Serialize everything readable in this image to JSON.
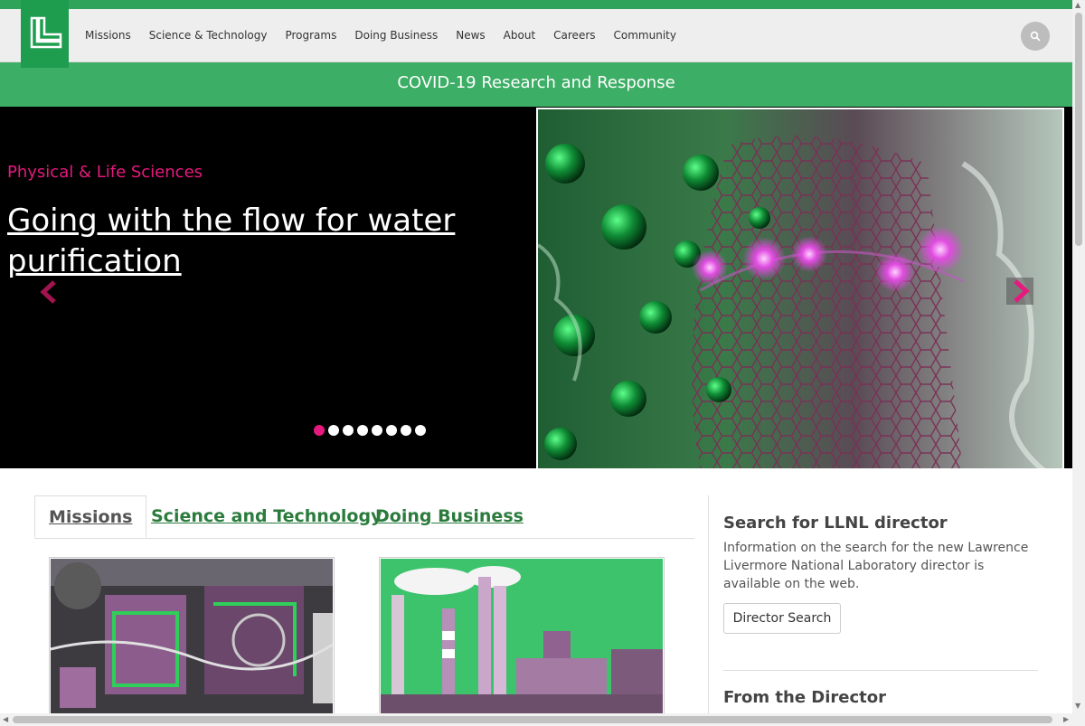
{
  "nav": {
    "items": [
      "Missions",
      "Science & Technology",
      "Programs",
      "Doing Business",
      "News",
      "About",
      "Careers",
      "Community"
    ]
  },
  "banner": {
    "text": "COVID-19 Research and Response"
  },
  "hero": {
    "category": "Physical & Life Sciences",
    "title": "Going with the flow for water purification",
    "slide_count": 8,
    "active_slide": 1
  },
  "tabs": [
    {
      "label": "Missions",
      "active": true
    },
    {
      "label": "Science and Technology",
      "active": false
    },
    {
      "label": "Doing Business",
      "active": false
    }
  ],
  "sidebar": {
    "heading": "Search for LLNL director",
    "text": "Information on the search for the new Lawrence Livermore National Laboratory director is available on the web.",
    "button_label": "Director Search",
    "heading2": "From the Director"
  },
  "colors": {
    "brand_green": "#1e9d4f",
    "banner_green": "#3dae66",
    "accent_pink": "#e6197e",
    "link_green": "#2a7b3c"
  }
}
